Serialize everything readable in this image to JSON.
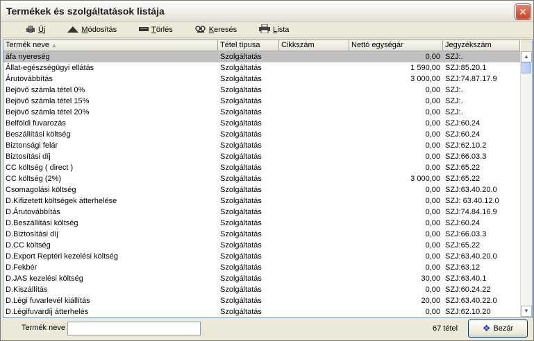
{
  "window": {
    "title": "Termékek és szolgáltatások listája",
    "close_glyph": "✕"
  },
  "toolbar": {
    "buttons": [
      {
        "label_ul": "Ú",
        "label_rest": "j",
        "icon": "new-icon"
      },
      {
        "label_ul": "M",
        "label_rest": "ódosítás",
        "icon": "edit-icon"
      },
      {
        "label_ul": "T",
        "label_rest": "örlés",
        "icon": "delete-icon"
      },
      {
        "label_ul": "K",
        "label_rest": "eresés",
        "icon": "search-icon"
      },
      {
        "label_ul": "L",
        "label_rest": "ista",
        "icon": "print-icon"
      }
    ]
  },
  "table": {
    "columns": [
      "Termék neve",
      "Tétel típusa",
      "Cikkszám",
      "Nettó egységár",
      "Jegyzékszám"
    ],
    "rows": [
      [
        "áfa nyereség",
        "Szolgáltatás",
        "",
        "0,00",
        "SZJ:."
      ],
      [
        "Állat-egészségügyi ellátás",
        "Szolgáltatás",
        "",
        "1 590,00",
        "SZJ:85.20.1"
      ],
      [
        "Árutovábbítás",
        "Szolgáltatás",
        "",
        "3 000,00",
        "SZJ:74.87.17.9"
      ],
      [
        "Bejövő számla tétel 0%",
        "Szolgáltatás",
        "",
        "0,00",
        "SZJ:."
      ],
      [
        "Bejövő számla tétel 15%",
        "Szolgáltatás",
        "",
        "0,00",
        "SZJ:."
      ],
      [
        "Bejövő számla tétel 20%",
        "Szolgáltatás",
        "",
        "0,00",
        "SZJ:."
      ],
      [
        "Belföldi fuvarozás",
        "Szolgáltatás",
        "",
        "0,00",
        "SZJ:60.24"
      ],
      [
        "Beszállítási költség",
        "Szolgáltatás",
        "",
        "0,00",
        "SZJ:60.24"
      ],
      [
        "Biztonsági felár",
        "Szolgáltatás",
        "",
        "0,00",
        "SZJ:62.10.2"
      ],
      [
        "Biztosítási díj",
        "Szolgáltatás",
        "",
        "0,00",
        "SZJ:66.03.3"
      ],
      [
        "CC költség ( direct )",
        "Szolgáltatás",
        "",
        "0,00",
        "SZJ:65.22"
      ],
      [
        "CC költség (2%)",
        "Szolgáltatás",
        "",
        "3 000,00",
        "SZJ:65.22"
      ],
      [
        "Csomagolási költség",
        "Szolgáltatás",
        "",
        "0,00",
        "SZJ:63.40.20.0"
      ],
      [
        "D.Kifizetett költségek átterhelése",
        "Szolgáltatás",
        "",
        "0,00",
        "SZJ: 63.40.12.0"
      ],
      [
        "D.Árutovábbítás",
        "Szolgáltatás",
        "",
        "0,00",
        "SZJ:74.84.16.9"
      ],
      [
        "D.Beszállítási költség",
        "Szolgáltatás",
        "",
        "0,00",
        "SZJ:60.24"
      ],
      [
        "D.Biztosítási díj",
        "Szolgáltatás",
        "",
        "0,00",
        "SZJ:66.03.3"
      ],
      [
        "D.CC költség",
        "Szolgáltatás",
        "",
        "0,00",
        "SZJ:65.22"
      ],
      [
        "D.Export Reptéri kezelési költség",
        "Szolgáltatás",
        "",
        "0,00",
        "SZJ:63.40.20.0"
      ],
      [
        "D.Fekbér",
        "Szolgáltatás",
        "",
        "0,00",
        "SZJ:63.12"
      ],
      [
        "D.JAS kezelési költség",
        "Szolgáltatás",
        "",
        "30,00",
        "SZJ:63.40.1"
      ],
      [
        "D.Kiszállítás",
        "Szolgáltatás",
        "",
        "0,00",
        "SZJ:60.24.22"
      ],
      [
        "D.Légi fuvarlevél kiállítás",
        "Szolgáltatás",
        "",
        "20,00",
        "SZJ:63.40.22.0"
      ],
      [
        "D.Légifuvardíj átterhelés",
        "Szolgáltatás",
        "",
        "0,00",
        "SZJ:62.10.20"
      ]
    ],
    "selected_row": 0
  },
  "footer": {
    "filter_label": "Termék neve",
    "filter_value": "",
    "count_text": "67 tétel",
    "close_label": "Bezár",
    "close_icon": "paw-icon"
  }
}
